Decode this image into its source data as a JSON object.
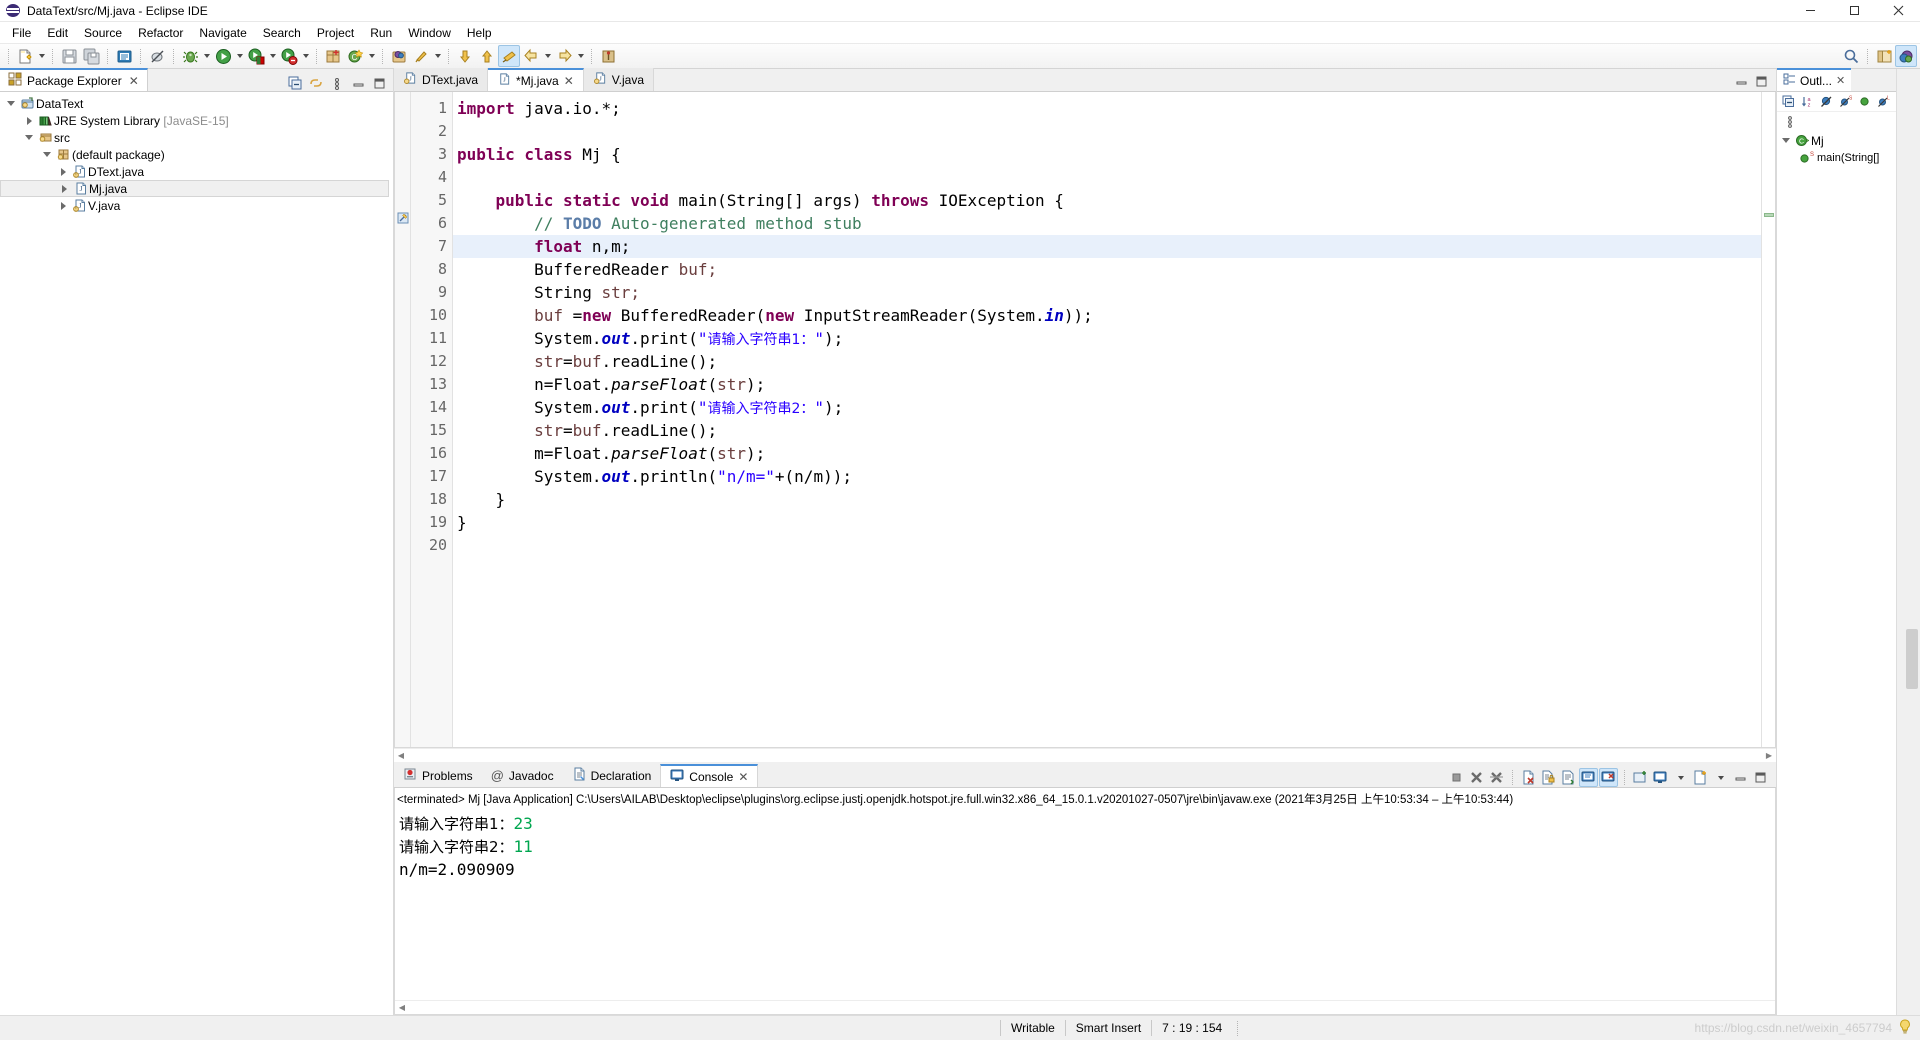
{
  "window": {
    "title": "DataText/src/Mj.java - Eclipse IDE",
    "logo": "eclipse-logo",
    "controls": {
      "minimize": "minimize-icon",
      "maximize": "maximize-icon",
      "close": "close-icon"
    }
  },
  "menubar": {
    "items": [
      "File",
      "Edit",
      "Source",
      "Refactor",
      "Navigate",
      "Search",
      "Project",
      "Run",
      "Window",
      "Help"
    ]
  },
  "toolbar": {
    "icons": [
      "new-wizard-icon",
      "save-icon",
      "save-all-icon",
      "print-icon",
      "toggle-mark-occurrences-icon",
      "debug-icon",
      "run-icon",
      "run-last-tool-icon",
      "coverage-icon",
      "new-java-package-icon",
      "new-java-class-icon",
      "open-type-icon",
      "search-icon",
      "next-annotation-icon",
      "previous-annotation-icon",
      "last-edit-location-icon",
      "back-icon",
      "forward-icon",
      "pin-editor-icon"
    ]
  },
  "package_explorer": {
    "tab_label": "Package Explorer",
    "tab_close": "close-icon",
    "view_tools": [
      "collapse-all-icon",
      "link-with-editor-icon",
      "view-menu-icon",
      "minimize-icon",
      "maximize-icon"
    ],
    "tree": [
      {
        "label": "DataText",
        "depth": 0,
        "twisty": "down",
        "icon": "java-project-icon",
        "suffix": ""
      },
      {
        "label": "JRE System Library",
        "depth": 1,
        "twisty": "right",
        "icon": "library-icon",
        "suffix": " [JavaSE-15]"
      },
      {
        "label": "src",
        "depth": 1,
        "twisty": "down",
        "icon": "source-folder-icon",
        "suffix": ""
      },
      {
        "label": "(default package)",
        "depth": 2,
        "twisty": "down",
        "icon": "package-icon",
        "suffix": ""
      },
      {
        "label": "DText.java",
        "depth": 3,
        "twisty": "right",
        "icon": "java-file-icon",
        "suffix": ""
      },
      {
        "label": "Mj.java",
        "depth": 3,
        "twisty": "right",
        "icon": "java-file-icon",
        "suffix": "",
        "selected": true
      },
      {
        "label": "V.java",
        "depth": 3,
        "twisty": "right",
        "icon": "java-file-icon",
        "suffix": ""
      }
    ]
  },
  "editor": {
    "tabs": [
      {
        "label": "DText.java",
        "icon": "java-file-icon",
        "active": false,
        "dirty": false
      },
      {
        "label": "*Mj.java",
        "icon": "java-file-icon",
        "active": true,
        "dirty": true,
        "close": "close-icon"
      },
      {
        "label": "V.java",
        "icon": "java-file-icon",
        "active": false,
        "dirty": false
      }
    ],
    "tab_right_tools": [
      "minimize-icon",
      "maximize-icon"
    ],
    "highlighted_line": 7,
    "fold_line": 5,
    "lines": [
      {
        "n": 1,
        "tokens": [
          {
            "t": "import",
            "c": "kw"
          },
          {
            "t": " java.io.*;",
            "c": "plain"
          }
        ]
      },
      {
        "n": 2,
        "tokens": []
      },
      {
        "n": 3,
        "tokens": [
          {
            "t": "public class",
            "c": "kw"
          },
          {
            "t": " Mj {",
            "c": "plain"
          }
        ]
      },
      {
        "n": 4,
        "tokens": []
      },
      {
        "n": 5,
        "tokens": [
          {
            "t": "    ",
            "c": "plain"
          },
          {
            "t": "public static void",
            "c": "kw"
          },
          {
            "t": " main(String[] args) ",
            "c": "plain"
          },
          {
            "t": "throws",
            "c": "kw"
          },
          {
            "t": " IOException {",
            "c": "plain"
          }
        ]
      },
      {
        "n": 6,
        "tokens": [
          {
            "t": "        ",
            "c": "plain"
          },
          {
            "t": "// ",
            "c": "cmt"
          },
          {
            "t": "TODO",
            "c": "todo"
          },
          {
            "t": " Auto-generated method stub",
            "c": "cmt"
          }
        ]
      },
      {
        "n": 7,
        "tokens": [
          {
            "t": "        ",
            "c": "plain"
          },
          {
            "t": "float",
            "c": "kw"
          },
          {
            "t": " n,m;",
            "c": "plain"
          }
        ]
      },
      {
        "n": 8,
        "tokens": [
          {
            "t": "        BufferedReader ",
            "c": "plain"
          },
          {
            "t": "buf;",
            "c": "loc"
          }
        ]
      },
      {
        "n": 9,
        "tokens": [
          {
            "t": "        String ",
            "c": "plain"
          },
          {
            "t": "str;",
            "c": "loc"
          }
        ]
      },
      {
        "n": 10,
        "tokens": [
          {
            "t": "        ",
            "c": "plain"
          },
          {
            "t": "buf ",
            "c": "loc"
          },
          {
            "t": "=",
            "c": "plain"
          },
          {
            "t": "new",
            "c": "kw"
          },
          {
            "t": " BufferedReader(",
            "c": "plain"
          },
          {
            "t": "new",
            "c": "kw"
          },
          {
            "t": " InputStreamReader(System.",
            "c": "plain"
          },
          {
            "t": "in",
            "c": "fld"
          },
          {
            "t": "));",
            "c": "plain"
          }
        ]
      },
      {
        "n": 11,
        "tokens": [
          {
            "t": "        System.",
            "c": "plain"
          },
          {
            "t": "out",
            "c": "fld"
          },
          {
            "t": ".print(",
            "c": "plain"
          },
          {
            "t": "\"",
            "c": "str"
          },
          {
            "t": "请输入字符串1：",
            "c": "str cjk"
          },
          {
            "t": "\"",
            "c": "str"
          },
          {
            "t": ");",
            "c": "plain"
          }
        ]
      },
      {
        "n": 12,
        "tokens": [
          {
            "t": "        ",
            "c": "plain"
          },
          {
            "t": "str",
            "c": "loc"
          },
          {
            "t": "=",
            "c": "plain"
          },
          {
            "t": "buf",
            "c": "loc"
          },
          {
            "t": ".readLine();",
            "c": "plain"
          }
        ]
      },
      {
        "n": 13,
        "tokens": [
          {
            "t": "        n=Float.",
            "c": "plain"
          },
          {
            "t": "parseFloat",
            "c": "mth"
          },
          {
            "t": "(",
            "c": "plain"
          },
          {
            "t": "str",
            "c": "loc"
          },
          {
            "t": ");",
            "c": "plain"
          }
        ]
      },
      {
        "n": 14,
        "tokens": [
          {
            "t": "        System.",
            "c": "plain"
          },
          {
            "t": "out",
            "c": "fld"
          },
          {
            "t": ".print(",
            "c": "plain"
          },
          {
            "t": "\"",
            "c": "str"
          },
          {
            "t": "请输入字符串2：",
            "c": "str cjk"
          },
          {
            "t": "\"",
            "c": "str"
          },
          {
            "t": ");",
            "c": "plain"
          }
        ]
      },
      {
        "n": 15,
        "tokens": [
          {
            "t": "        ",
            "c": "plain"
          },
          {
            "t": "str",
            "c": "loc"
          },
          {
            "t": "=",
            "c": "plain"
          },
          {
            "t": "buf",
            "c": "loc"
          },
          {
            "t": ".readLine();",
            "c": "plain"
          }
        ]
      },
      {
        "n": 16,
        "tokens": [
          {
            "t": "        m=Float.",
            "c": "plain"
          },
          {
            "t": "parseFloat",
            "c": "mth"
          },
          {
            "t": "(",
            "c": "plain"
          },
          {
            "t": "str",
            "c": "loc"
          },
          {
            "t": ");",
            "c": "plain"
          }
        ]
      },
      {
        "n": 17,
        "tokens": [
          {
            "t": "        System.",
            "c": "plain"
          },
          {
            "t": "out",
            "c": "fld"
          },
          {
            "t": ".println(",
            "c": "plain"
          },
          {
            "t": "\"n/m=\"",
            "c": "str"
          },
          {
            "t": "+(n/m));",
            "c": "plain"
          }
        ]
      },
      {
        "n": 18,
        "tokens": [
          {
            "t": "    }",
            "c": "plain"
          }
        ]
      },
      {
        "n": 19,
        "tokens": [
          {
            "t": "}",
            "c": "plain"
          }
        ]
      },
      {
        "n": 20,
        "tokens": []
      }
    ]
  },
  "console": {
    "tabs": [
      {
        "label": "Problems",
        "icon": "problems-icon",
        "active": false
      },
      {
        "label": "Javadoc",
        "icon": "javadoc-icon",
        "active": false
      },
      {
        "label": "Declaration",
        "icon": "declaration-icon",
        "active": false
      },
      {
        "label": "Console",
        "icon": "console-icon",
        "active": true,
        "close": "close-icon"
      }
    ],
    "tools": [
      "terminate-icon",
      "remove-launch-icon",
      "remove-all-terminated-icon",
      "clear-console-icon",
      "scroll-lock-icon",
      "word-wrap-icon",
      "show-console-on-output-icon",
      "show-console-on-error-icon",
      "pin-console-icon",
      "display-selected-console-icon",
      "open-console-icon",
      "minimize-icon",
      "maximize-icon"
    ],
    "terminated_line": "<terminated> Mj [Java Application] C:\\Users\\AILAB\\Desktop\\eclipse\\plugins\\org.eclipse.justj.openjdk.hotspot.jre.full.win32.x86_64_15.0.1.v20201027-0507\\jre\\bin\\javaw.exe  (2021年3月25日 上午10:53:34 – 上午10:53:44)",
    "output": [
      {
        "parts": [
          {
            "t": "请输入字符串1：",
            "c": "ocjk"
          },
          {
            "t": "23",
            "c": "oin"
          }
        ]
      },
      {
        "parts": [
          {
            "t": "请输入字符串2：",
            "c": "ocjk"
          },
          {
            "t": "11",
            "c": "oin"
          }
        ]
      },
      {
        "parts": [
          {
            "t": "n/m=2.090909",
            "c": "plain"
          }
        ]
      }
    ]
  },
  "outline": {
    "tab_label": "Outl...",
    "tab_close": "close-icon",
    "tools": [
      "collapse-all-icon",
      "sort-icon",
      "hide-fields-icon",
      "hide-static-icon",
      "hide-nonpublic-icon",
      "hide-local-types-icon",
      "view-menu-icon"
    ],
    "tree": [
      {
        "label": "Mj",
        "depth": 0,
        "twisty": "down",
        "icon": "class-icon"
      },
      {
        "label": "main(String[]",
        "depth": 1,
        "twisty": "none",
        "icon": "method-public-static-icon"
      }
    ]
  },
  "statusbar": {
    "writable": "Writable",
    "insert_mode": "Smart Insert",
    "position": "7 : 19 : 154",
    "watermark": "https://blog.csdn.net/weixin_4657794",
    "hint_icon": "lightbulb-icon"
  }
}
